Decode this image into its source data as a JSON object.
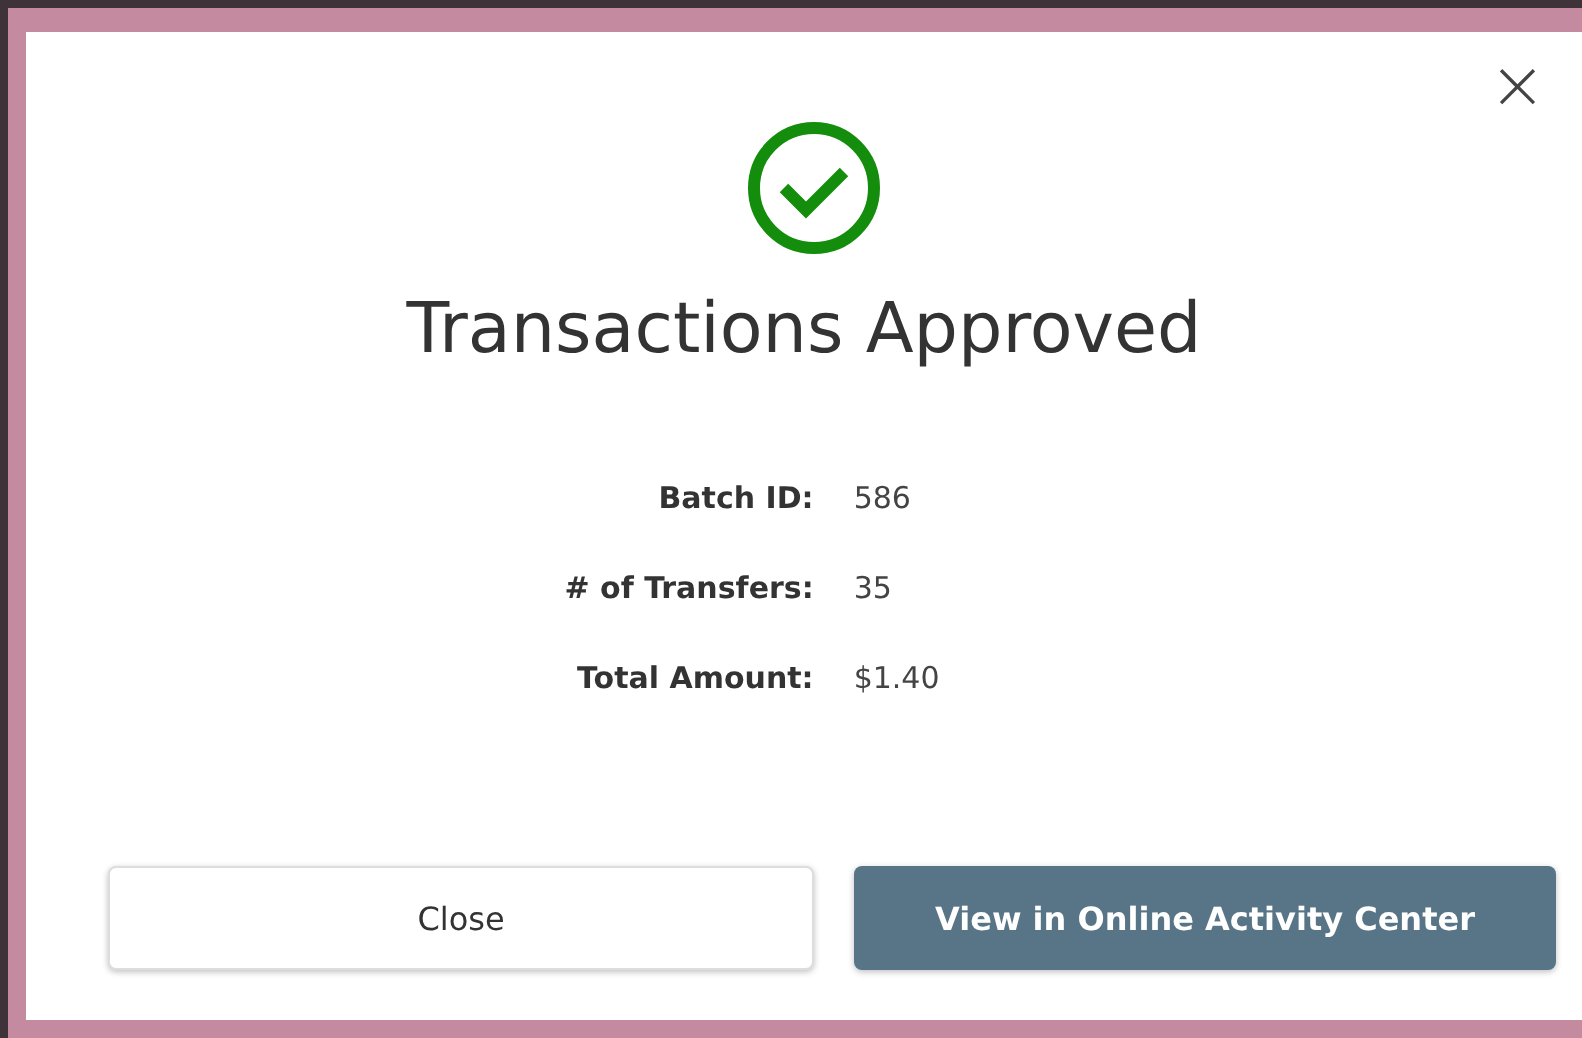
{
  "dialog": {
    "close_glyph": "×",
    "title": "Transactions Approved",
    "details": [
      {
        "label": "Batch ID:",
        "value": "586"
      },
      {
        "label": "# of Transfers:",
        "value": "35"
      },
      {
        "label": "Total Amount:",
        "value": "$1.40"
      }
    ],
    "buttons": [
      {
        "label": "Close",
        "kind": "secondary"
      },
      {
        "label": "View in Online Activity Center",
        "kind": "primary"
      }
    ]
  }
}
